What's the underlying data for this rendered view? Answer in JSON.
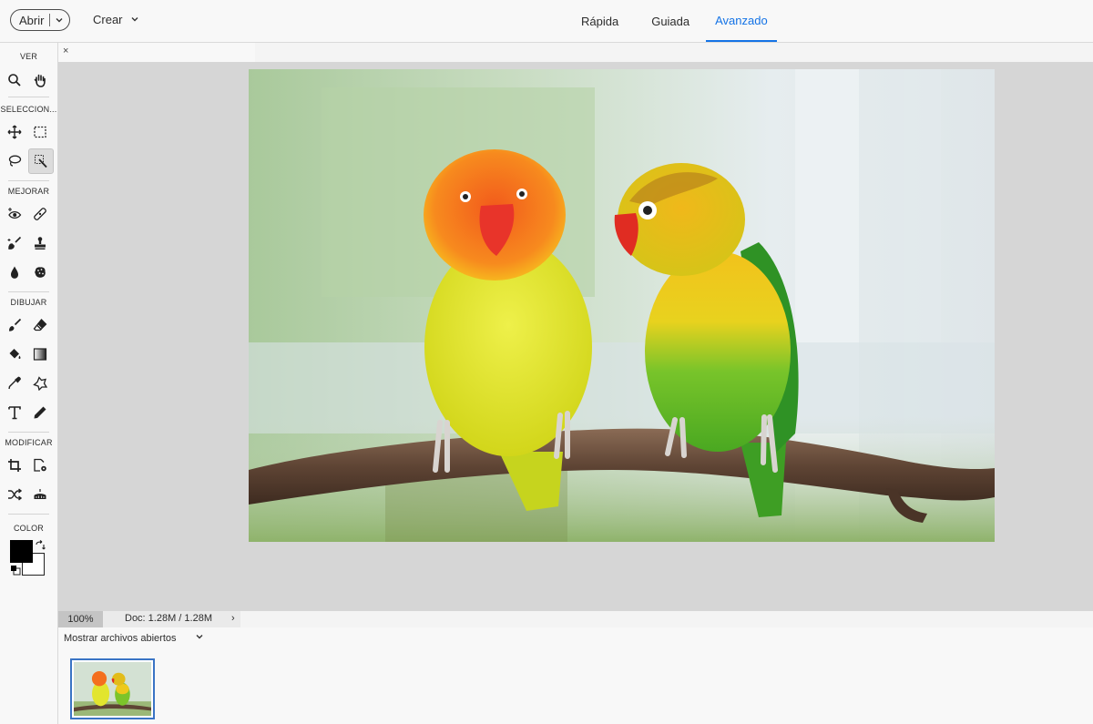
{
  "topbar": {
    "open_label": "Abrir",
    "create_label": "Crear",
    "modes": [
      "Rápida",
      "Guiada",
      "Avanzado"
    ],
    "active_mode": "Avanzado"
  },
  "toolbar": {
    "sections": {
      "view": "VER",
      "select": "SELECCION...",
      "enhance": "MEJORAR",
      "draw": "DIBUJAR",
      "modify": "MODIFICAR",
      "color": "COLOR"
    },
    "tools": {
      "view": [
        "zoom-icon",
        "hand-icon"
      ],
      "select": [
        "move-icon",
        "marquee-icon",
        "lasso-icon",
        "quick-selection-icon"
      ],
      "enhance": [
        "red-eye-icon",
        "spot-healing-icon",
        "smart-brush-icon",
        "clone-stamp-icon",
        "blur-icon",
        "sponge-icon"
      ],
      "draw": [
        "brush-icon",
        "eraser-icon",
        "paint-bucket-icon",
        "gradient-icon",
        "eyedropper-icon",
        "custom-shape-icon",
        "type-icon",
        "pencil-icon"
      ],
      "modify": [
        "crop-icon",
        "recompose-icon",
        "content-aware-move-icon",
        "straighten-icon"
      ]
    },
    "selected_tool": "quick-selection-icon",
    "foreground_color": "#000000",
    "background_color": "#ffffff"
  },
  "document": {
    "close_glyph": "×",
    "image_subject": "two lovebirds on a branch"
  },
  "status": {
    "zoom": "100%",
    "doc_size": "Doc: 1.28M / 1.28M",
    "arrow": "›"
  },
  "photo_bin": {
    "dropdown_label": "Mostrar archivos abiertos"
  },
  "colors": {
    "accent": "#1473e6",
    "workspace": "#d6d6d6",
    "thumbnail_border": "#3a74c5"
  }
}
